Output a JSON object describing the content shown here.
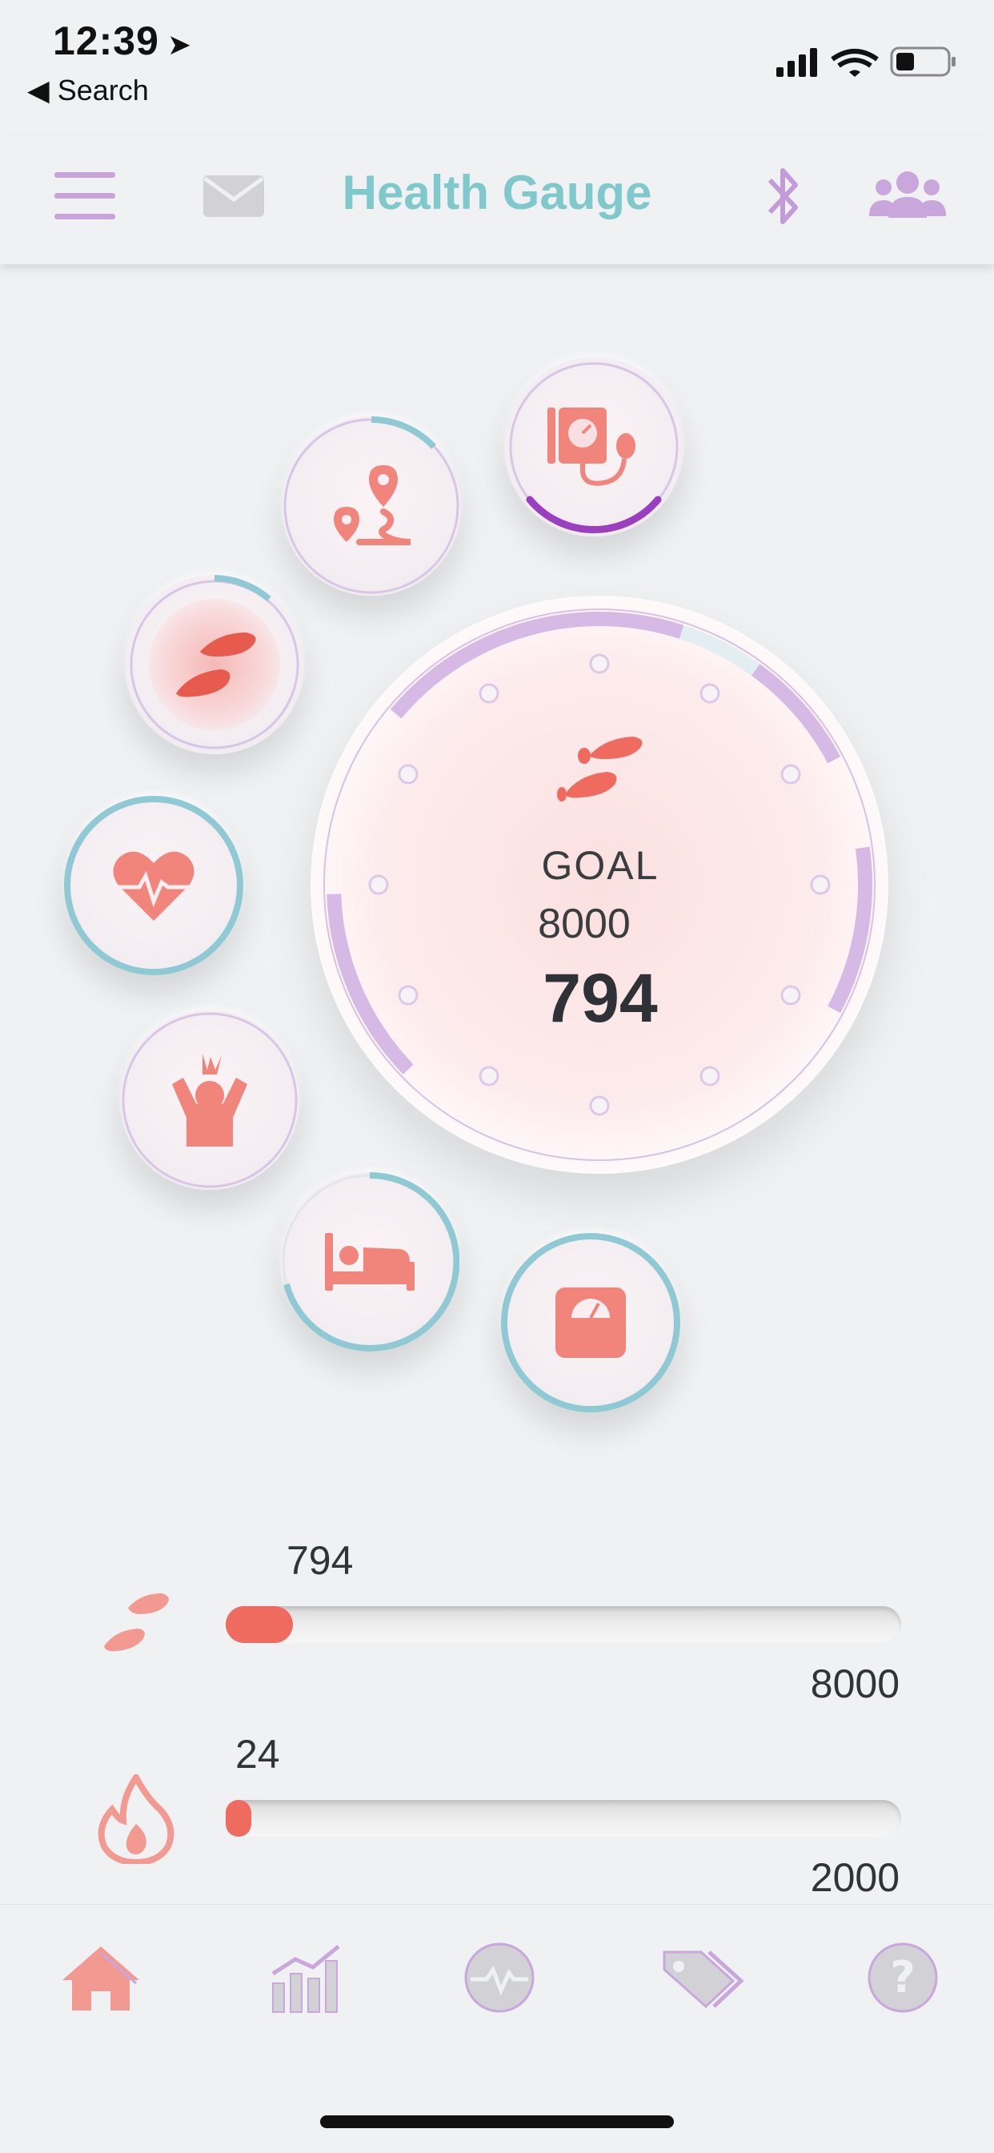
{
  "status_bar": {
    "time": "12:39",
    "back_label": "◀ Search"
  },
  "header": {
    "title": "Health Gauge"
  },
  "icons": {
    "menu": "menu-icon",
    "messages": "envelope-icon",
    "bluetooth": "bluetooth-icon",
    "group": "group-icon",
    "blood_pressure": "blood-pressure-icon",
    "distance": "route-icon",
    "steps": "footprints-icon",
    "heart_rate": "heart-rate-icon",
    "stress": "stress-icon",
    "sleep": "bed-icon",
    "weight": "scale-icon",
    "calories": "flame-icon"
  },
  "gauge": {
    "goal_label": "GOAL",
    "goal_value": "8000",
    "current_value": "794"
  },
  "progress": {
    "steps": {
      "value": "794",
      "max": "8000",
      "fraction": 0.099
    },
    "calories": {
      "value": "24",
      "max": "2000",
      "fraction": 0.012
    }
  },
  "tabs": [
    "home-icon",
    "statistics-icon",
    "activity-icon",
    "tags-icon",
    "help-icon"
  ],
  "colors": {
    "accent": "#7fc8cc",
    "coral": "#ef6a5f",
    "lavender": "#d7b9e6",
    "teal": "#8fc9d3",
    "purple": "#9a3fbf"
  }
}
